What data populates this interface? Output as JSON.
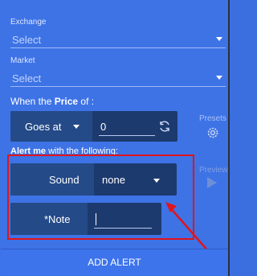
{
  "exchange": {
    "label": "Exchange",
    "value": "Select"
  },
  "market": {
    "label": "Market",
    "value": "Select"
  },
  "price": {
    "label_prefix": "When the",
    "label_bold": "Price",
    "label_suffix": "of :",
    "condition": "Goes at",
    "value": "0"
  },
  "presets": {
    "label": "Presets"
  },
  "alert_me": {
    "label_bold": "Alert me",
    "label_rest": "with the following:"
  },
  "preview": {
    "label": "Preview"
  },
  "sound": {
    "label": "Sound",
    "value": "none"
  },
  "note": {
    "label": "*Note",
    "value": ""
  },
  "add_alert": {
    "label": "ADD ALERT"
  },
  "colors": {
    "panel": "#3e73e6",
    "highlight": "#e0141c",
    "dark_box": "#1d3a6e"
  }
}
